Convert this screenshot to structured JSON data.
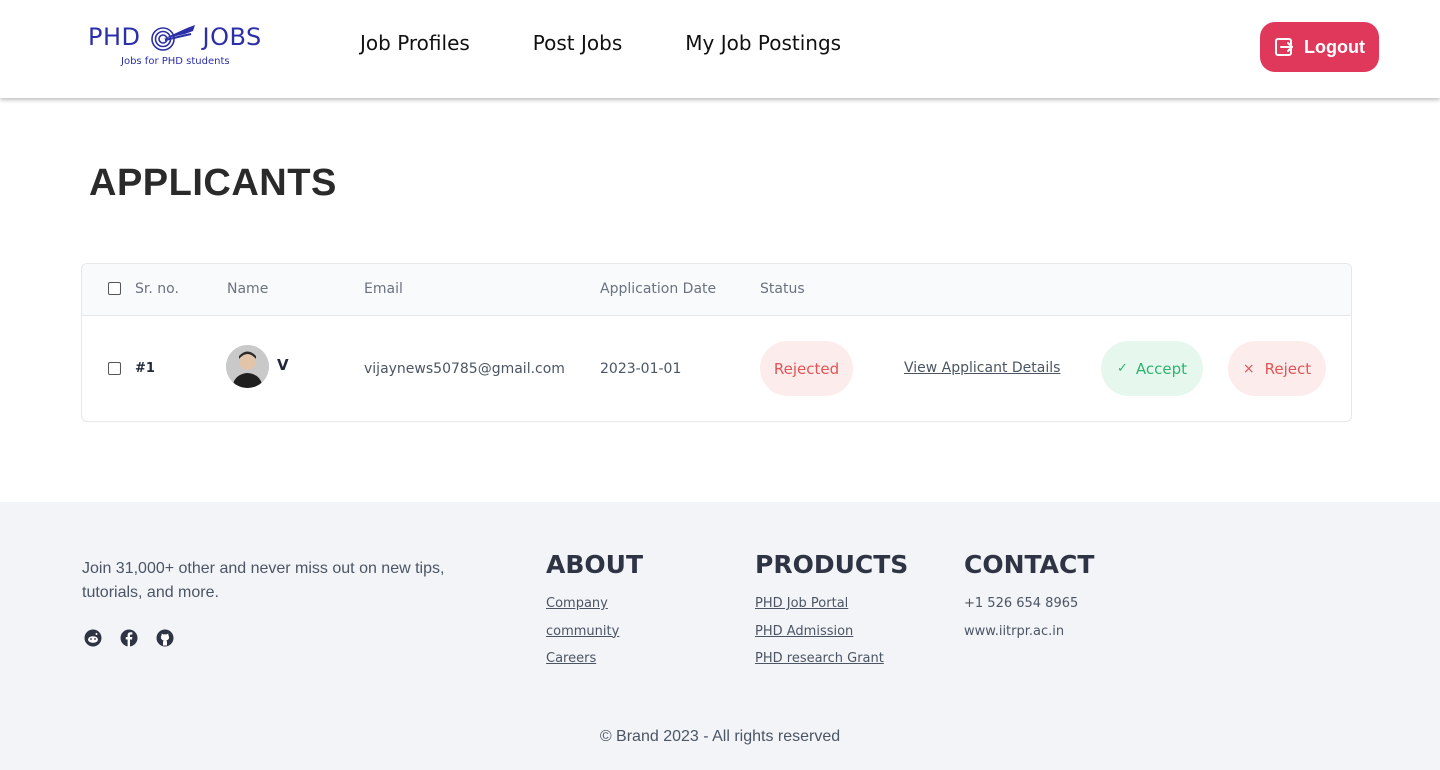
{
  "header": {
    "logo_left": "PHD",
    "logo_right": "JOBS",
    "logo_tagline": "Jobs for PHD students",
    "nav": [
      "Job Profiles",
      "Post Jobs",
      "My Job Postings"
    ],
    "logout_label": "Logout"
  },
  "page": {
    "title": "APPLICANTS"
  },
  "table": {
    "headers": {
      "sr": "Sr. no.",
      "name": "Name",
      "email": "Email",
      "date": "Application Date",
      "status": "Status"
    },
    "rows": [
      {
        "sr": "#1",
        "name": "V",
        "email": "vijaynews50785@gmail.com",
        "date": "2023-01-01",
        "status": "Rejected",
        "view_label": "View Applicant Details",
        "accept_label": "Accept",
        "reject_label": "Reject"
      }
    ]
  },
  "footer": {
    "tagline": "Join 31,000+ other and never miss out on new tips, tutorials, and more.",
    "socials": [
      "reddit-icon",
      "facebook-icon",
      "github-icon"
    ],
    "about": {
      "title": "ABOUT",
      "links": [
        "Company",
        "community",
        "Careers"
      ]
    },
    "products": {
      "title": "PRODUCTS",
      "links": [
        "PHD Job Portal",
        "PHD Admission",
        "PHD research Grant"
      ]
    },
    "contact": {
      "title": "CONTACT",
      "items": [
        "+1 526 654 8965",
        "www.iitrpr.ac.in"
      ]
    },
    "copyright": "© Brand 2023 - All rights reserved"
  },
  "colors": {
    "brand": "#2b2fa8",
    "logout": "#e0385a",
    "rejected_bg": "#fdecec",
    "rejected_text": "#e05555",
    "accept_bg": "#e6f8ee",
    "accept_text": "#2fb36f",
    "footer_bg": "#f3f4f8"
  }
}
